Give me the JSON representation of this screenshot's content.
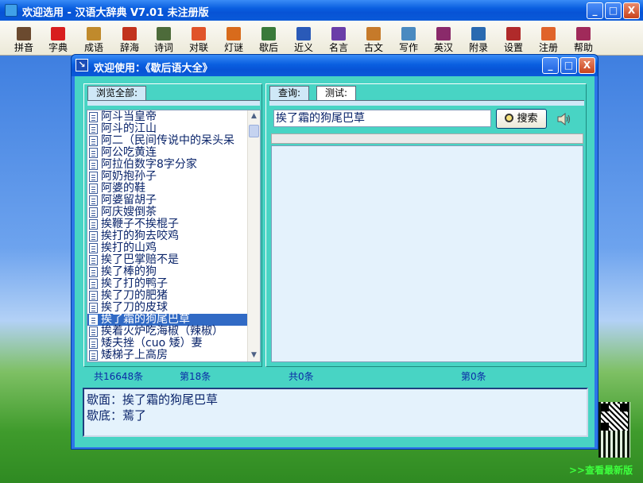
{
  "app": {
    "title": "欢迎选用 - 汉语大辞典 V7.01 未注册版",
    "window_buttons": [
      "_",
      "□",
      "X"
    ]
  },
  "toolbar": {
    "items": [
      {
        "label": "拼音",
        "icon": "face-icon",
        "color": "#6b4a2f"
      },
      {
        "label": "字典",
        "icon": "book-red-icon",
        "color": "#d81e1e"
      },
      {
        "label": "成语",
        "icon": "books-stack-icon",
        "color": "#c08a2c"
      },
      {
        "label": "辞海",
        "icon": "open-book-icon",
        "color": "#c2331d"
      },
      {
        "label": "诗词",
        "icon": "scroll-icon",
        "color": "#4d6b3a"
      },
      {
        "label": "对联",
        "icon": "couplet-icon",
        "color": "#e0542a"
      },
      {
        "label": "灯谜",
        "icon": "lantern-icon",
        "color": "#d86b1c"
      },
      {
        "label": "歇后",
        "icon": "cards-icon",
        "color": "#3a7a3a"
      },
      {
        "label": "近义",
        "icon": "book-blue-icon",
        "color": "#2a5ab8"
      },
      {
        "label": "名言",
        "icon": "pen-note-icon",
        "color": "#6a3ea8"
      },
      {
        "label": "古文",
        "icon": "bamboo-slips-icon",
        "color": "#c67a2a"
      },
      {
        "label": "写作",
        "icon": "write-icon",
        "color": "#4a8ac0"
      },
      {
        "label": "英汉",
        "icon": "dictionary-icon",
        "color": "#8a2a6a"
      },
      {
        "label": "附录",
        "icon": "appendix-icon",
        "color": "#2a6ab0"
      },
      {
        "label": "设置",
        "icon": "settings-icon",
        "color": "#b02a2a"
      },
      {
        "label": "注册",
        "icon": "register-icon",
        "color": "#e0642a"
      },
      {
        "label": "帮助",
        "icon": "help-book-icon",
        "color": "#a02a5a"
      }
    ]
  },
  "dialog": {
    "title": "欢迎使用：《歇后语大全》",
    "left_tab": "浏览全部:",
    "right_tabs": [
      "查询:",
      "测试:"
    ],
    "list_items": [
      "阿斗当皇帝",
      "阿斗的江山",
      "阿二（民间传说中的呆头呆",
      "阿公吃黄连",
      "阿拉伯数字8字分家",
      "阿奶抱孙子",
      "阿婆的鞋",
      "阿婆留胡子",
      "阿庆嫂倒茶",
      "挨鞭子不挨棍子",
      "挨打的狗去咬鸡",
      "挨打的山鸡",
      "挨了巴掌赔不是",
      "挨了棒的狗",
      "挨了打的鸭子",
      "挨了刀的肥猪",
      "挨了刀的皮球",
      "挨了霜的狗尾巴草",
      "挨着火炉吃海椒（辣椒）",
      "矮夫挫（cuo 矮）妻",
      "矮梯子上高房"
    ],
    "selected_index": 17,
    "search": {
      "value": "挨了霜的狗尾巴草",
      "button_label": "搜索"
    },
    "status": {
      "total": "共16648条",
      "current": "第18条",
      "result_total": "共0条",
      "result_current": "第0条"
    },
    "detail": {
      "line1": "歇面：挨了霜的狗尾巴草",
      "line2": "歇底：蔫了"
    }
  },
  "desktop": {
    "update_link": ">>查看最新版"
  }
}
